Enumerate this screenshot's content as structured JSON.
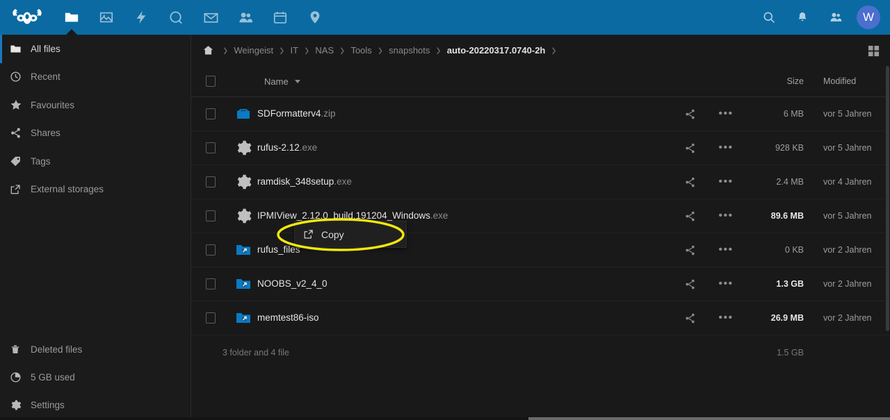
{
  "header": {
    "logo": "koala-logo",
    "nav_items": [
      {
        "name": "files",
        "icon": "folder-icon",
        "active": true
      },
      {
        "name": "photos",
        "icon": "image-icon",
        "active": false
      },
      {
        "name": "activity",
        "icon": "lightning-icon",
        "active": false
      },
      {
        "name": "search",
        "icon": "circle-search-icon",
        "active": false
      },
      {
        "name": "mail",
        "icon": "envelope-icon",
        "active": false
      },
      {
        "name": "contacts",
        "icon": "people-icon",
        "active": false
      },
      {
        "name": "calendar",
        "icon": "calendar-icon",
        "active": false
      },
      {
        "name": "maps",
        "icon": "map-pin-icon",
        "active": false
      }
    ],
    "right_items": [
      {
        "name": "search",
        "icon": "magnifier-icon"
      },
      {
        "name": "notifications",
        "icon": "bell-icon"
      },
      {
        "name": "contacts-menu",
        "icon": "contacts-icon"
      }
    ],
    "avatar_initial": "W",
    "avatar_color": "#4b6fcf",
    "bar_color": "#0b6aa2"
  },
  "sidebar": {
    "top_items": [
      {
        "label": "All files",
        "icon": "folder-icon",
        "active": true
      },
      {
        "label": "Recent",
        "icon": "clock-icon",
        "active": false
      },
      {
        "label": "Favourites",
        "icon": "star-icon",
        "active": false
      },
      {
        "label": "Shares",
        "icon": "share-icon",
        "active": false
      },
      {
        "label": "Tags",
        "icon": "tag-icon",
        "active": false
      },
      {
        "label": "External storages",
        "icon": "external-link-icon",
        "active": false
      }
    ],
    "bottom_items": [
      {
        "label": "Deleted files",
        "icon": "trash-icon"
      },
      {
        "label": "5 GB used",
        "icon": "pie-chart-icon"
      },
      {
        "label": "Settings",
        "icon": "gear-icon"
      }
    ]
  },
  "breadcrumb": {
    "home_icon": "home-icon",
    "separator": "›",
    "items": [
      {
        "label": "Weingeist",
        "current": false
      },
      {
        "label": "IT",
        "current": false
      },
      {
        "label": "NAS",
        "current": false
      },
      {
        "label": "Tools",
        "current": false
      },
      {
        "label": "snapshots",
        "current": false
      },
      {
        "label": "auto-20220317.0740-2h",
        "current": true
      }
    ],
    "grid_toggle_icon": "grid-view-icon"
  },
  "table": {
    "headers": {
      "name": "Name",
      "size": "Size",
      "modified": "Modified",
      "sort_icon": "caret-down-icon"
    },
    "rows": [
      {
        "name": "SDFormatterv4",
        "ext": ".zip",
        "icon": "zip-archive-icon",
        "size": "6 MB",
        "size_bold": false,
        "modified": "vor 5 Jahren"
      },
      {
        "name": "rufus-2.12",
        "ext": ".exe",
        "icon": "gear-icon",
        "size": "928 KB",
        "size_bold": false,
        "modified": "vor 5 Jahren"
      },
      {
        "name": "ramdisk_348setup",
        "ext": ".exe",
        "icon": "gear-icon",
        "size": "2.4 MB",
        "size_bold": false,
        "modified": "vor 4 Jahren"
      },
      {
        "name": "IPMIView_2.12.0_build.191204_Windows",
        "ext": ".exe",
        "icon": "gear-icon",
        "size": "89.6 MB",
        "size_bold": true,
        "modified": "vor 5 Jahren"
      },
      {
        "name": "rufus_files",
        "ext": "",
        "icon": "external-folder-icon",
        "size": "0 KB",
        "size_bold": false,
        "modified": "vor 2 Jahren"
      },
      {
        "name": "NOOBS_v2_4_0",
        "ext": "",
        "icon": "external-folder-icon",
        "size": "1.3 GB",
        "size_bold": true,
        "modified": "vor 2 Jahren"
      },
      {
        "name": "memtest86-iso",
        "ext": "",
        "icon": "external-folder-icon",
        "size": "26.9 MB",
        "size_bold": true,
        "modified": "vor 2 Jahren"
      }
    ],
    "row_actions": {
      "share_icon": "share-icon",
      "more_icon": "ellipsis-icon"
    },
    "summary": {
      "label": "3 folder and 4 file",
      "size": "1.5 GB"
    }
  },
  "context_menu": {
    "items": [
      {
        "label": "Copy",
        "icon": "external-link-icon"
      }
    ]
  },
  "annotation": {
    "shape": "ellipse",
    "color": "#f2e80c",
    "target": "Copy"
  }
}
